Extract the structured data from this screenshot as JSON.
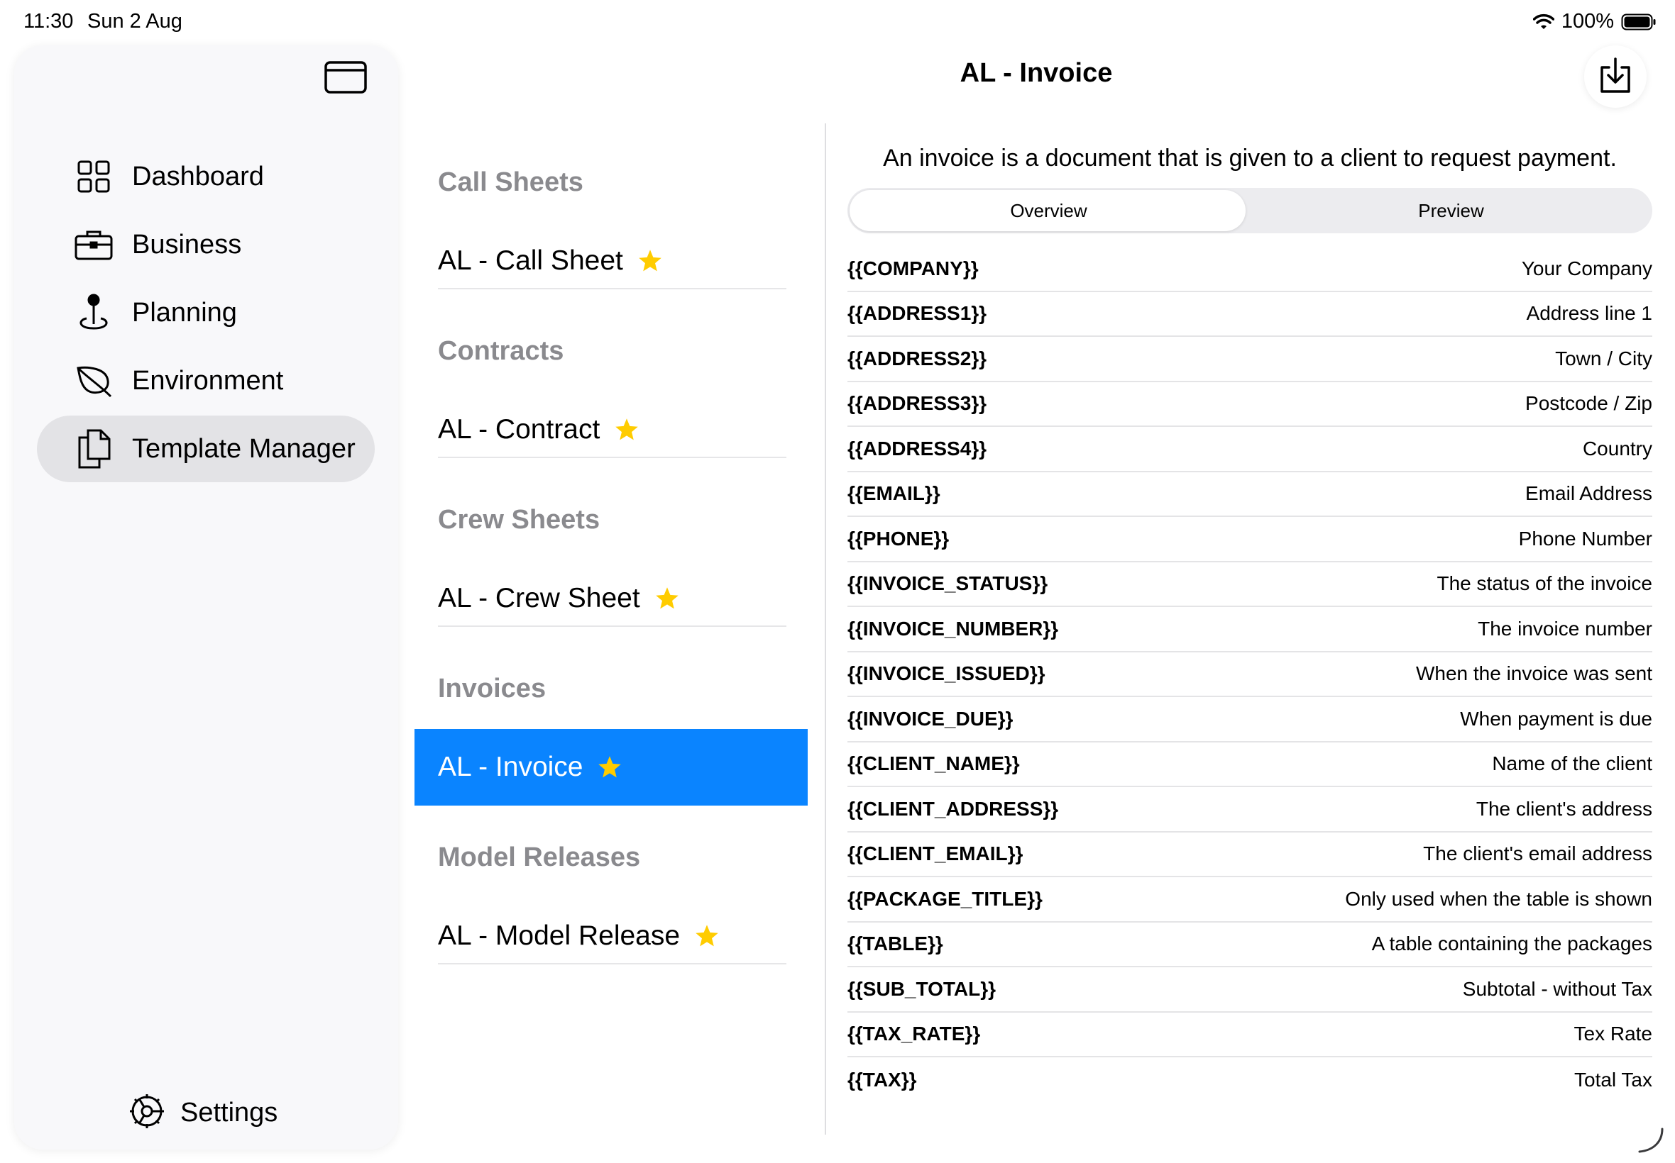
{
  "status": {
    "time": "11:30",
    "date": "Sun 2 Aug",
    "battery": "100%"
  },
  "sidebar": {
    "items": [
      {
        "label": "Dashboard",
        "icon": "grid-icon"
      },
      {
        "label": "Business",
        "icon": "briefcase-icon"
      },
      {
        "label": "Planning",
        "icon": "location-pin-icon"
      },
      {
        "label": "Environment",
        "icon": "leaf-icon"
      },
      {
        "label": "Template Manager",
        "icon": "documents-icon",
        "active": true
      }
    ],
    "settings_label": "Settings"
  },
  "header": {
    "title": "AL - Invoice"
  },
  "templates": {
    "sections": [
      {
        "title": "Call Sheets",
        "item": "AL - Call Sheet"
      },
      {
        "title": "Contracts",
        "item": "AL - Contract"
      },
      {
        "title": "Crew Sheets",
        "item": "AL - Crew Sheet"
      },
      {
        "title": "Invoices",
        "item": "AL - Invoice",
        "selected": true
      },
      {
        "title": "Model Releases",
        "item": "AL - Model Release"
      }
    ]
  },
  "detail": {
    "description": "An invoice is a document that is given to a client to request payment.",
    "tabs": [
      "Overview",
      "Preview"
    ],
    "selected_tab": "Overview",
    "variables": [
      {
        "key": "{{COMPANY}}",
        "desc": "Your Company"
      },
      {
        "key": "{{ADDRESS1}}",
        "desc": "Address line 1"
      },
      {
        "key": "{{ADDRESS2}}",
        "desc": "Town / City"
      },
      {
        "key": "{{ADDRESS3}}",
        "desc": "Postcode / Zip"
      },
      {
        "key": "{{ADDRESS4}}",
        "desc": "Country"
      },
      {
        "key": "{{EMAIL}}",
        "desc": "Email Address"
      },
      {
        "key": "{{PHONE}}",
        "desc": "Phone Number"
      },
      {
        "key": "{{INVOICE_STATUS}}",
        "desc": "The status of the invoice"
      },
      {
        "key": "{{INVOICE_NUMBER}}",
        "desc": "The invoice number"
      },
      {
        "key": "{{INVOICE_ISSUED}}",
        "desc": "When the invoice was sent"
      },
      {
        "key": "{{INVOICE_DUE}}",
        "desc": "When payment is due"
      },
      {
        "key": "{{CLIENT_NAME}}",
        "desc": "Name of the client"
      },
      {
        "key": "{{CLIENT_ADDRESS}}",
        "desc": "The client's address"
      },
      {
        "key": "{{CLIENT_EMAIL}}",
        "desc": "The client's email address"
      },
      {
        "key": "{{PACKAGE_TITLE}}",
        "desc": "Only used when the table is shown"
      },
      {
        "key": "{{TABLE}}",
        "desc": "A table containing the packages"
      },
      {
        "key": "{{SUB_TOTAL}}",
        "desc": "Subtotal - without Tax"
      },
      {
        "key": "{{TAX_RATE}}",
        "desc": "Tex Rate"
      },
      {
        "key": "{{TAX}}",
        "desc": "Total Tax"
      }
    ]
  },
  "colors": {
    "accent": "#0a84ff",
    "star": "#ffcc00",
    "section_title": "#8a8a8e"
  }
}
